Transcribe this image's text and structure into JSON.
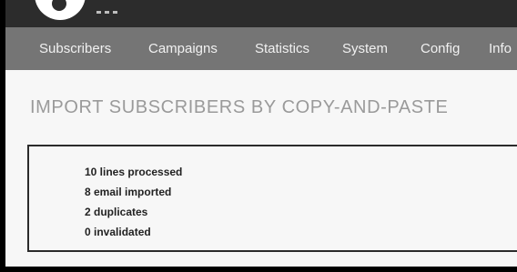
{
  "nav": {
    "items": [
      {
        "label": "Subscribers"
      },
      {
        "label": "Campaigns"
      },
      {
        "label": "Statistics"
      },
      {
        "label": "System"
      },
      {
        "label": "Config"
      },
      {
        "label": "Info"
      }
    ]
  },
  "page": {
    "title": "IMPORT SUBSCRIBERS BY COPY-AND-PASTE"
  },
  "import_result": {
    "lines": [
      "10 lines processed",
      "8 email imported",
      "2 duplicates",
      "0 invalidated"
    ]
  },
  "colors": {
    "topbar": "#2c2c2c",
    "navbar": "#757575",
    "nav_text": "#f1f1f1",
    "title_text": "#9a9a9a",
    "content_bg": "#f7f7f7",
    "box_border": "#2b2b2b"
  },
  "icons": {
    "logo": "app-logo-icon"
  }
}
